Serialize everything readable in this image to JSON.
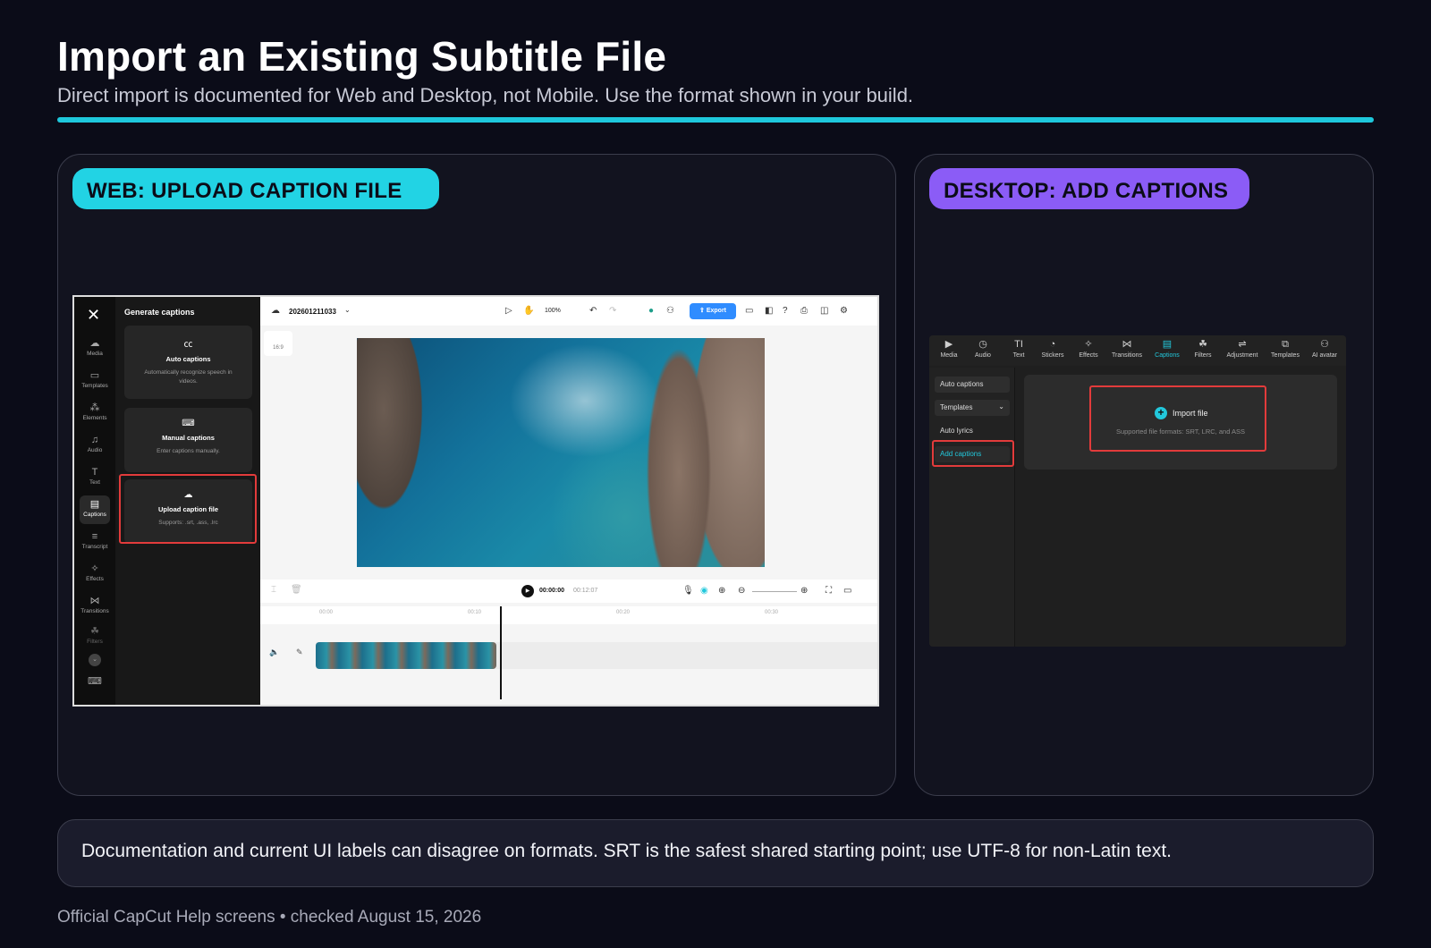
{
  "header": {
    "title": "Import an Existing Subtitle File",
    "subtitle": "Direct import is documented for Web and Desktop, not Mobile. Use the format shown in your build."
  },
  "web_panel": {
    "label": "WEB: UPLOAD CAPTION FILE",
    "screenshot": {
      "rail": [
        {
          "label": "Media",
          "icon": "cloud-icon"
        },
        {
          "label": "Templates",
          "icon": "templates-icon"
        },
        {
          "label": "Elements",
          "icon": "elements-icon"
        },
        {
          "label": "Audio",
          "icon": "audio-icon"
        },
        {
          "label": "Text",
          "icon": "text-icon"
        },
        {
          "label": "Captions",
          "icon": "captions-icon",
          "active": true
        },
        {
          "label": "Transcript",
          "icon": "transcript-icon"
        },
        {
          "label": "Effects",
          "icon": "effects-icon"
        },
        {
          "label": "Transitions",
          "icon": "transitions-icon"
        },
        {
          "label": "Filters",
          "icon": "filters-icon"
        }
      ],
      "side_title": "Generate captions",
      "cards": [
        {
          "title": "Auto captions",
          "desc": "Automatically recognize speech in videos."
        },
        {
          "title": "Manual captions",
          "desc": "Enter captions manually."
        },
        {
          "title": "Upload caption file",
          "desc": "Supports: .srt, .ass, .lrc",
          "highlighted": true
        }
      ],
      "project_name": "202601211033",
      "zoom": "100%",
      "export_label": "Export",
      "aspect_ratio": "16:9",
      "time_current": "00:00:00",
      "time_total": "00:12:07",
      "ruler_ticks": [
        "00:00",
        "00:10",
        "00:20",
        "00:30"
      ]
    }
  },
  "desktop_panel": {
    "label": "DESKTOP: ADD CAPTIONS",
    "screenshot": {
      "tabs": [
        {
          "label": "Media",
          "icon": "media-icon"
        },
        {
          "label": "Audio",
          "icon": "audio-icon"
        },
        {
          "label": "Text",
          "icon": "text-icon"
        },
        {
          "label": "Stickers",
          "icon": "stickers-icon"
        },
        {
          "label": "Effects",
          "icon": "effects-icon"
        },
        {
          "label": "Transitions",
          "icon": "transitions-icon"
        },
        {
          "label": "Captions",
          "icon": "captions-icon",
          "active": true
        },
        {
          "label": "Filters",
          "icon": "filters-icon"
        },
        {
          "label": "Adjustment",
          "icon": "adjustment-icon"
        },
        {
          "label": "Templates",
          "icon": "templates-icon"
        },
        {
          "label": "AI avatar",
          "icon": "avatar-icon"
        }
      ],
      "left_items": [
        "Auto captions",
        "Templates",
        "Auto lyrics",
        "Add captions"
      ],
      "import_label": "Import file",
      "import_formats": "Supported file formats: SRT, LRC, and ASS"
    }
  },
  "note": "Documentation and current UI labels can disagree on formats. SRT is the safest shared starting point; use UTF-8 for non-Latin text.",
  "footer": "Official CapCut Help screens • checked August 15, 2026",
  "colors": {
    "accent_cyan": "#22d3e4",
    "accent_purple": "#8b5cf6",
    "highlight_red": "#e23b3b",
    "background": "#0b0c18"
  }
}
